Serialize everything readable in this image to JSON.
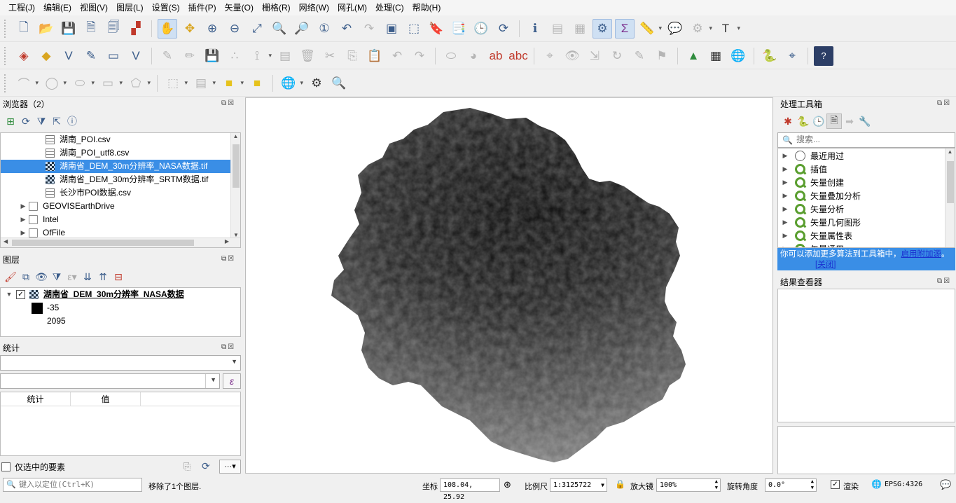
{
  "menu": [
    "工程(J)",
    "编辑(E)",
    "视图(V)",
    "图层(L)",
    "设置(S)",
    "插件(P)",
    "矢量(O)",
    "栅格(R)",
    "网络(W)",
    "网孔(M)",
    "处理(C)",
    "帮助(H)"
  ],
  "browser": {
    "title": "浏览器（2）",
    "items": [
      {
        "label": "湖南_POI.csv",
        "type": "csv"
      },
      {
        "label": "湖南_POI_utf8.csv",
        "type": "csv"
      },
      {
        "label": "湖南省_DEM_30m分辨率_NASA数据.tif",
        "type": "tif",
        "selected": true
      },
      {
        "label": "湖南省_DEM_30m分辨率_SRTM数据.tif",
        "type": "tif"
      },
      {
        "label": "长沙市POI数据.csv",
        "type": "csv"
      },
      {
        "label": "GEOVISEarthDrive",
        "type": "folder"
      },
      {
        "label": "Intel",
        "type": "folder"
      },
      {
        "label": "OfFile",
        "type": "folder"
      }
    ]
  },
  "layers": {
    "title": "图层",
    "layer_name": "湖南省_DEM_30m分辨率_NASA数据",
    "legend_min": "-35",
    "legend_max": "2095"
  },
  "stats": {
    "title": "统计",
    "col_stat": "统计",
    "col_value": "值",
    "selected_only": "仅选中的要素"
  },
  "processing": {
    "title": "处理工具箱",
    "search_placeholder": "搜索...",
    "items": [
      "最近用过",
      "插值",
      "矢量创建",
      "矢量叠加分析",
      "矢量分析",
      "矢量几何图形",
      "矢量属性表",
      "矢量通用"
    ],
    "notice_text": "你可以添加更多算法到工具箱中，",
    "notice_link": "启用附加源",
    "notice_tail": "。",
    "notice_close": "[关闭]"
  },
  "results": {
    "title": "结果查看器"
  },
  "status": {
    "locator_placeholder": "键入以定位(Ctrl+K)",
    "message": "移除了1个图层.",
    "coord_label": "坐标",
    "coord_value": "108.04, 25.92",
    "scale_label": "比例尺",
    "scale_value": "1:3125722",
    "magnifier_label": "放大镜",
    "magnifier_value": "100%",
    "rotation_label": "旋转角度",
    "rotation_value": "0.0°",
    "render_label": "渲染",
    "crs": "EPSG:4326"
  }
}
